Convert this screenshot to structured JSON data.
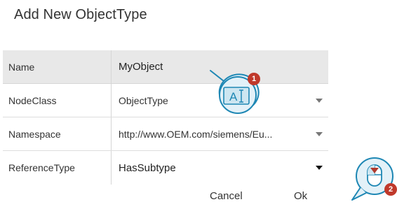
{
  "dialog": {
    "title": "Add New ObjectType"
  },
  "properties": [
    {
      "label": "Name",
      "value": "MyObject"
    },
    {
      "label": "NodeClass",
      "value": "ObjectType"
    },
    {
      "label": "Namespace",
      "value": "http://www.OEM.com/siemens/Eu..."
    },
    {
      "label": "ReferenceType",
      "value": "HasSubtype"
    }
  ],
  "buttons": {
    "cancel": "Cancel",
    "ok": "Ok"
  },
  "callouts": {
    "text_edit_icon_label": "A",
    "badge_1": "1",
    "badge_2": "2"
  },
  "colors": {
    "header_row_bg": "#e8e8e8",
    "callout_fill": "#e3f1f8",
    "callout_stroke": "#1e87b4",
    "badge_bg": "#c0392b"
  }
}
